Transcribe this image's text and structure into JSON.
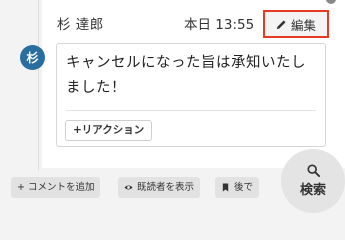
{
  "message": {
    "author": "杉 達郎",
    "time": "本日 13:55",
    "edit_label": "編集",
    "avatar_initial": "杉",
    "text": "キャンセルになった旨は承知いたしました！",
    "reaction_label": "+リアクション"
  },
  "actions": {
    "add_comment_label": "+ コメントを追加",
    "show_readers_label": "既読者を表示",
    "later_label": "後で"
  },
  "search": {
    "label": "検索"
  },
  "colors": {
    "avatar": "#2a6ea0",
    "highlight": "#e63a24"
  }
}
